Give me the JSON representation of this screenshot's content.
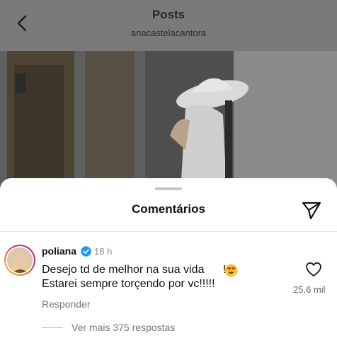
{
  "header": {
    "title": "Posts",
    "subtitle": "anacastelacantora",
    "back_icon": "chevron-left-icon"
  },
  "post": {
    "image_description_icon": "photo"
  },
  "comments_sheet": {
    "title": "Comentários",
    "share_icon": "send-icon"
  },
  "comment": {
    "username": "poliana",
    "verified_icon": "verified-badge-icon",
    "time": "18 h",
    "text": "Desejo td de melhor na sua vida ",
    "text_suffix": "!!!",
    "text_line2": "Estarei sempre torçendo por vc!!!!!",
    "emoji_icon": "heart-eyes-emoji-icon",
    "like_icon": "heart-icon",
    "likes": "25,6 mil",
    "reply_label": "Responder",
    "more_replies_label": "Ver mais 375 respostas"
  },
  "colors": {
    "overlay": "#7a7a7a",
    "verified": "#1d9bf0"
  }
}
